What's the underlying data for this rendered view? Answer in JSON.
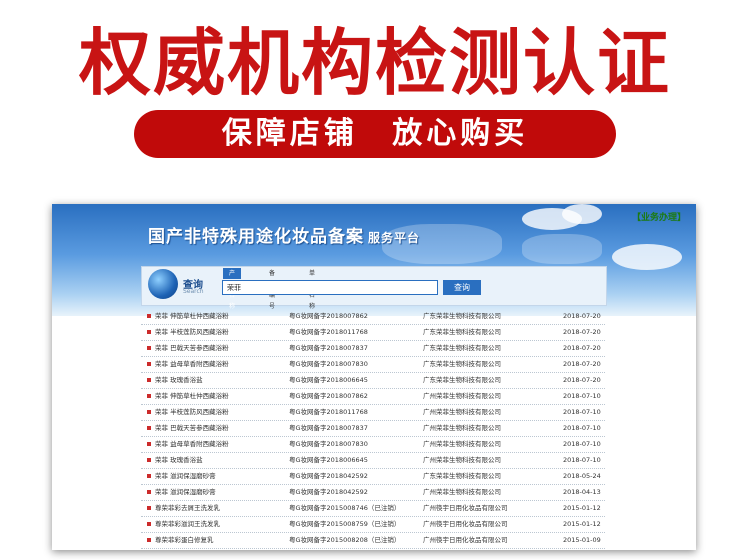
{
  "headline": "权威机构检测认证",
  "pill": {
    "left": "保障店铺",
    "right": "放心购买"
  },
  "banner": {
    "title": "国产非特殊用途化妆品备案",
    "subtitle": "服务平台",
    "biz_link": "【业务办理】"
  },
  "search": {
    "label": "查询",
    "sub_label": "Search",
    "tabs": [
      "产品名称",
      "备案编号",
      "单位名称"
    ],
    "input_value": "荣菲",
    "button": "查询"
  },
  "results": [
    {
      "name": "荣菲 伸筋草杜仲西藏浴粉",
      "code": "粤G妆网备字2018007862",
      "company": "广东荣菲生物科技有限公司",
      "date": "2018-07-20"
    },
    {
      "name": "荣菲 半枝莲防风西藏浴粉",
      "code": "粤G妆网备字2018011768",
      "company": "广东荣菲生物科技有限公司",
      "date": "2018-07-20"
    },
    {
      "name": "荣菲 巴戟天苦参西藏浴粉",
      "code": "粤G妆网备字2018007837",
      "company": "广东荣菲生物科技有限公司",
      "date": "2018-07-20"
    },
    {
      "name": "荣菲 益母草香附西藏浴粉",
      "code": "粤G妆网备字2018007830",
      "company": "广东荣菲生物科技有限公司",
      "date": "2018-07-20"
    },
    {
      "name": "荣菲 玫瑰香浴盐",
      "code": "粤G妆网备字2018006645",
      "company": "广东荣菲生物科技有限公司",
      "date": "2018-07-20"
    },
    {
      "name": "荣菲 伸筋草杜仲西藏浴粉",
      "code": "粤G妆网备字2018007862",
      "company": "广州荣菲生物科技有限公司",
      "date": "2018-07-10"
    },
    {
      "name": "荣菲 半枝莲防风西藏浴粉",
      "code": "粤G妆网备字2018011768",
      "company": "广州荣菲生物科技有限公司",
      "date": "2018-07-10"
    },
    {
      "name": "荣菲 巴戟天苦参西藏浴粉",
      "code": "粤G妆网备字2018007837",
      "company": "广州荣菲生物科技有限公司",
      "date": "2018-07-10"
    },
    {
      "name": "荣菲 益母草香附西藏浴粉",
      "code": "粤G妆网备字2018007830",
      "company": "广州荣菲生物科技有限公司",
      "date": "2018-07-10"
    },
    {
      "name": "荣菲 玫瑰香浴盐",
      "code": "粤G妆网备字2018006645",
      "company": "广州荣菲生物科技有限公司",
      "date": "2018-07-10"
    },
    {
      "name": "荣菲 滋润保湿磨砂膏",
      "code": "粤G妆网备字2018042592",
      "company": "广东荣菲生物科技有限公司",
      "date": "2018-05-24"
    },
    {
      "name": "荣菲 滋润保湿磨砂膏",
      "code": "粤G妆网备字2018042592",
      "company": "广州荣菲生物科技有限公司",
      "date": "2018-04-13"
    },
    {
      "name": "尊荣菲彩去屑王洗发乳",
      "code": "粤G妆网备字2015008746（已注销）",
      "company": "广州筷宇日用化妆品有限公司",
      "date": "2015-01-12"
    },
    {
      "name": "尊荣菲彩滋润王洗发乳",
      "code": "粤G妆网备字2015008759（已注销）",
      "company": "广州筷宇日用化妆品有限公司",
      "date": "2015-01-12"
    },
    {
      "name": "尊荣菲彩蛋白修复乳",
      "code": "粤G妆网备字2015008208（已注销）",
      "company": "广州筷宇日用化妆品有限公司",
      "date": "2015-01-09"
    }
  ],
  "colors": {
    "headline": "#c81414",
    "pill": "#c00a0a",
    "banner": "#2a6fc0"
  }
}
